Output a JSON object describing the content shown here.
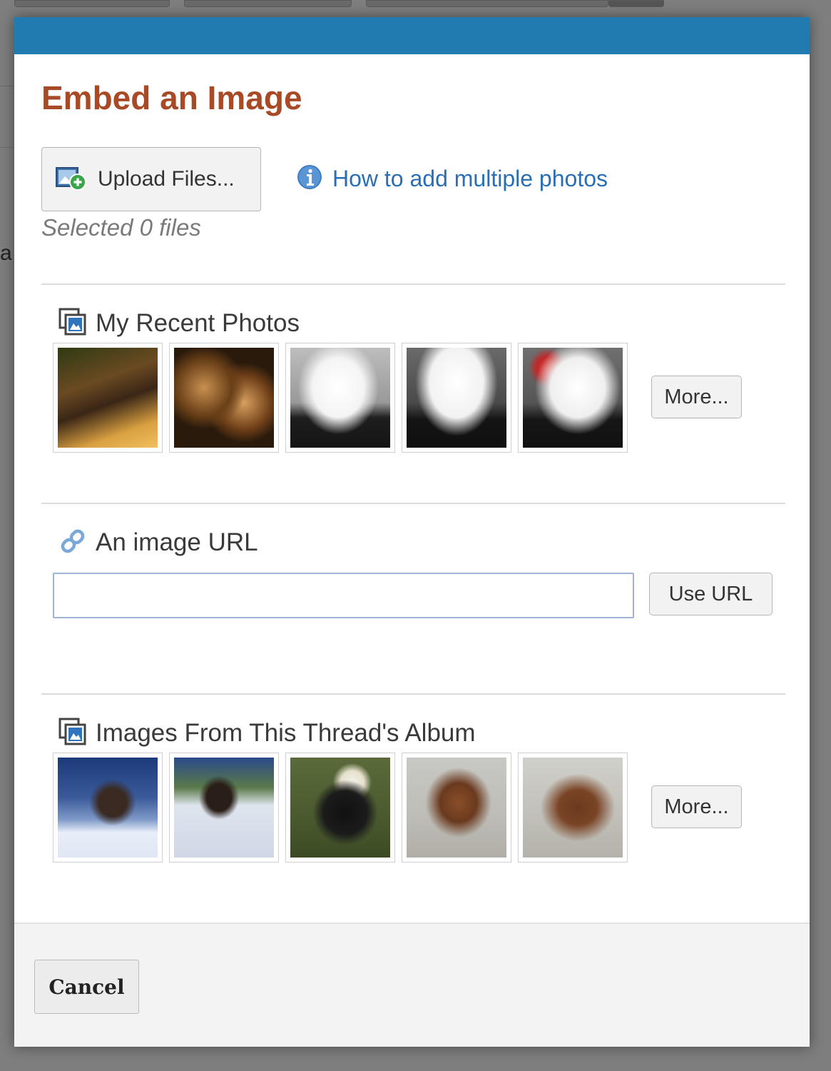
{
  "dialog": {
    "title": "Embed an Image",
    "upload_label": "Upload Files...",
    "help_link": "How to add multiple photos",
    "selected_count": "Selected 0 files"
  },
  "recent_photos": {
    "heading": "My Recent Photos",
    "more_label": "More...",
    "photo_count": 5
  },
  "image_url": {
    "heading": "An image URL",
    "input_value": "",
    "button_label": "Use URL"
  },
  "thread_album": {
    "heading": "Images From This Thread's Album",
    "more_label": "More...",
    "photo_count": 5
  },
  "footer": {
    "cancel_label": "Cancel"
  },
  "colors": {
    "topbar": "#1f7bb0",
    "title": "#a84a25",
    "link": "#2a6fb5"
  }
}
